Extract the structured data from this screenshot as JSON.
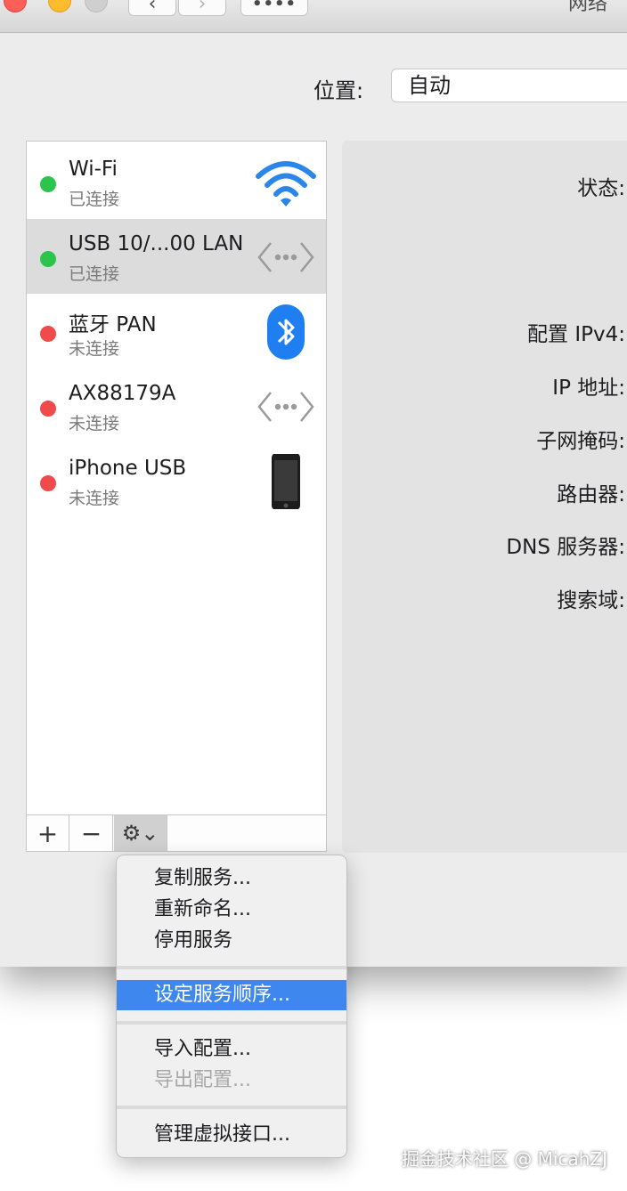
{
  "window": {
    "title": "网络"
  },
  "toolbar": {
    "back": "‹",
    "forward": "›",
    "show_all": "••••"
  },
  "location": {
    "label": "位置:",
    "value": "自动"
  },
  "services": [
    {
      "name": "Wi-Fi",
      "status": "已连接",
      "state": "connected",
      "icon": "wifi-icon"
    },
    {
      "name": "USB 10/...00 LAN",
      "status": "已连接",
      "state": "connected",
      "icon": "ethernet-icon",
      "selected": true
    },
    {
      "name": "蓝牙 PAN",
      "status": "未连接",
      "state": "disconnected",
      "icon": "bluetooth-icon"
    },
    {
      "name": "AX88179A",
      "status": "未连接",
      "state": "disconnected",
      "icon": "ethernet-icon"
    },
    {
      "name": "iPhone USB",
      "status": "未连接",
      "state": "disconnected",
      "icon": "iphone-icon"
    }
  ],
  "list_toolbar": {
    "add": "+",
    "remove": "−",
    "gear": "⚙⌄"
  },
  "detail": {
    "status": "状态:",
    "ipv4": "配置 IPv4:",
    "ip": "IP 地址:",
    "subnet": "子网掩码:",
    "router": "路由器:",
    "dns": "DNS 服务器:",
    "search": "搜索域:"
  },
  "menu": {
    "duplicate": "复制服务...",
    "rename": "重新命名...",
    "deactivate": "停用服务",
    "set_order": "设定服务顺序...",
    "import": "导入配置...",
    "export": "导出配置...",
    "manage_virtual": "管理虚拟接口..."
  },
  "colors": {
    "connected": "#2ac54a",
    "disconnected": "#f14a4a",
    "highlight": "#3d87ee"
  },
  "watermark": "掘金技术社区 @ MicahZJ"
}
